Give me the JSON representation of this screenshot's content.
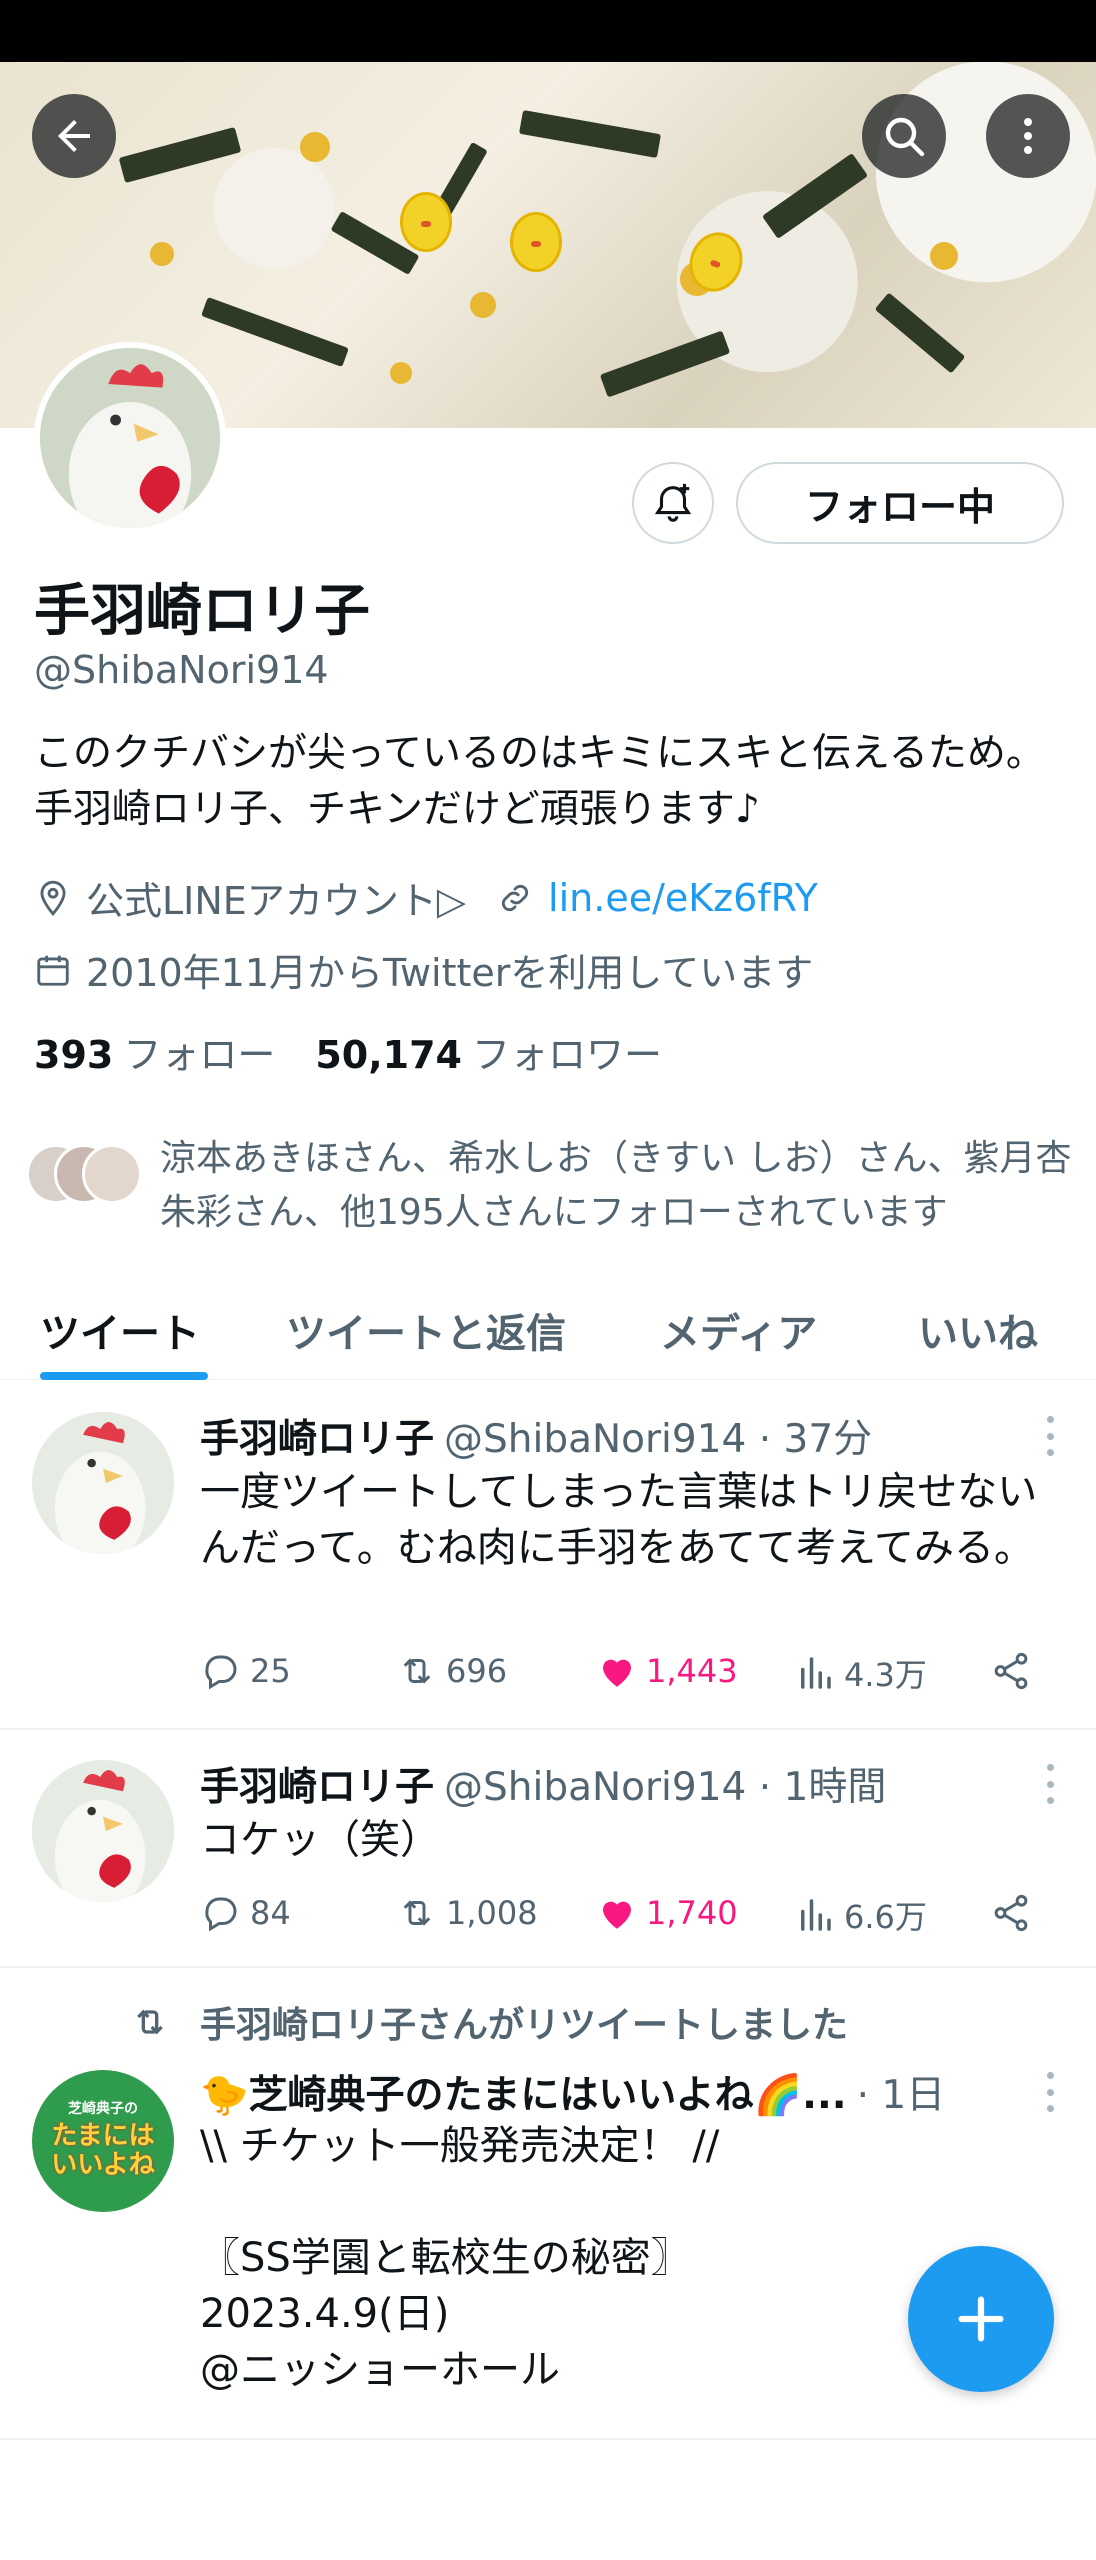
{
  "profile": {
    "name": "手羽崎ロリ子",
    "handle": "@ShibaNori914",
    "bio": "このクチバシが尖っているのはキミにスキと伝えるため。手羽崎ロリ子、チキンだけど頑張ります♪",
    "location": "公式LINEアカウント▷",
    "link": "lin.ee/eKz6fRY",
    "joined": "2010年11月からTwitterを利用しています",
    "following_count": "393",
    "following_label": "フォロー",
    "followers_count": "50,174",
    "followers_label": "フォロワー",
    "followed_by": "涼本あきほさん、希水しお（きすい しお）さん、紫月杏朱彩さん、他195人さんにフォローされています",
    "follow_button": "フォロー中"
  },
  "tabs": [
    {
      "label": "ツイート",
      "active": true
    },
    {
      "label": "ツイートと返信",
      "active": false
    },
    {
      "label": "メディア",
      "active": false
    },
    {
      "label": "いいね",
      "active": false
    }
  ],
  "tweets": [
    {
      "name": "手羽崎ロリ子",
      "handle": "@ShibaNori914",
      "time": "· 37分",
      "text": "一度ツイートしてしまった言葉はトリ戻せないんだって。むね肉に手羽をあてて考えてみる。",
      "replies": "25",
      "retweets": "696",
      "likes": "1,443",
      "views": "4.3万"
    },
    {
      "name": "手羽崎ロリ子",
      "handle": "@ShibaNori914",
      "time": "· 1時間",
      "text": "コケッ（笑）",
      "replies": "84",
      "retweets": "1,008",
      "likes": "1,740",
      "views": "6.6万"
    },
    {
      "retweet_note": "手羽崎ロリ子さんがリツイートしました",
      "name": "🐤芝崎典子のたまにはいいよね🌈...",
      "time": "· 1日",
      "text": "\\\\ チケット一般発売決定！ //\n\n〖SS学園と転校生の秘密〗\n2023.4.9(日)\n@ニッショーホール",
      "avatar_text_small": "芝崎典子の",
      "avatar_text_large": "たまには いいよね"
    }
  ],
  "colors": {
    "accent": "#1d9bf0",
    "like": "#f91880",
    "text": "#0f1419",
    "secondary": "#536471"
  }
}
